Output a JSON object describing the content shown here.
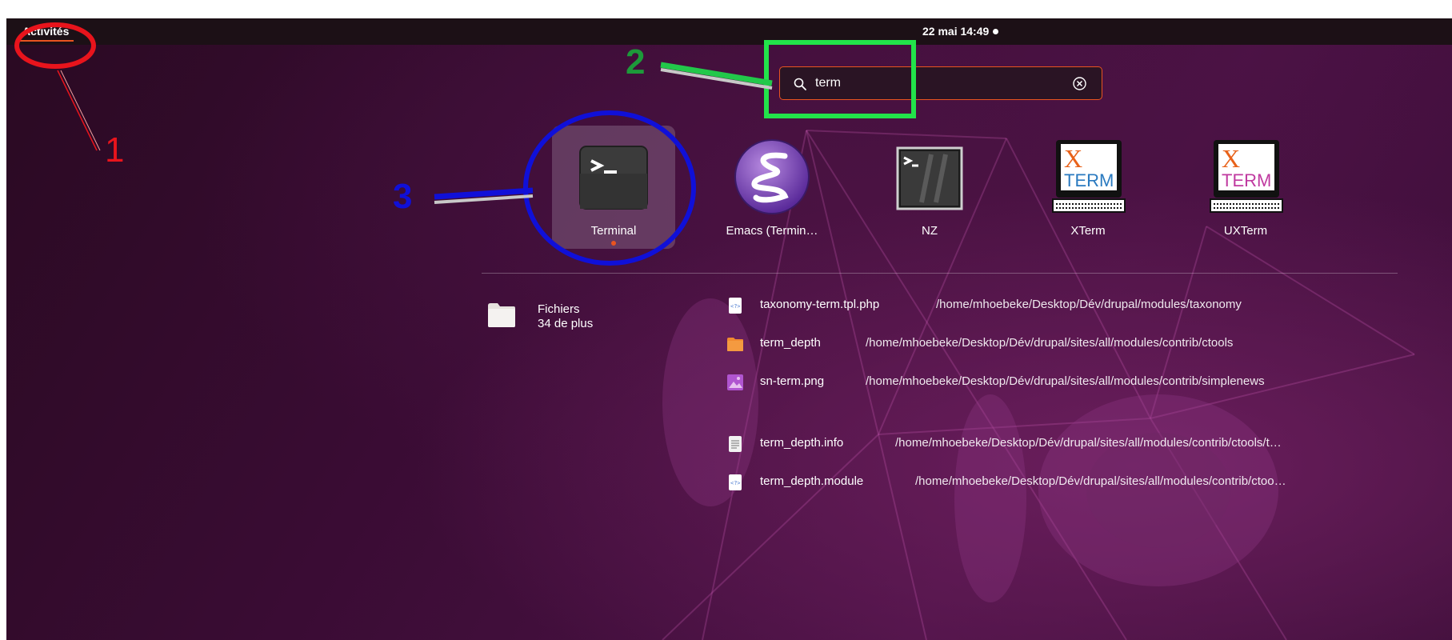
{
  "topbar": {
    "activities_label": "Activités",
    "clock": "22 mai  14:49"
  },
  "search": {
    "value": "term",
    "placeholder": ""
  },
  "apps": [
    {
      "label": "Terminal",
      "icon": "terminal-icon",
      "selected": true,
      "running": true
    },
    {
      "label": "Emacs (Termin…",
      "icon": "emacs-icon"
    },
    {
      "label": "NZ",
      "icon": "nz-terminal-icon"
    },
    {
      "label": "XTerm",
      "icon": "xterm-icon"
    },
    {
      "label": "UXTerm",
      "icon": "uxterm-icon"
    }
  ],
  "files_provider": {
    "name": "Fichiers",
    "more": "34 de plus"
  },
  "results": [
    {
      "name": "taxonomy-term.tpl.php",
      "path": "/home/mhoebeke/Desktop/Dév/drupal/modules/taxonomy",
      "icon": "php-file-icon"
    },
    {
      "name": "term_depth",
      "path": "/home/mhoebeke/Desktop/Dév/drupal/sites/all/modules/contrib/ctools",
      "icon": "folder-icon"
    },
    {
      "name": "sn-term.png",
      "path": "/home/mhoebeke/Desktop/Dév/drupal/sites/all/modules/contrib/simplenews",
      "icon": "image-file-icon"
    },
    {
      "name": "term_depth.info",
      "path": "/home/mhoebeke/Desktop/Dév/drupal/sites/all/modules/contrib/ctools/t…",
      "icon": "text-file-icon"
    },
    {
      "name": "term_depth.module",
      "path": "/home/mhoebeke/Desktop/Dév/drupal/sites/all/modules/contrib/ctoo…",
      "icon": "php-file-icon"
    }
  ],
  "annotations": [
    {
      "number": "1",
      "color": "#e8141c"
    },
    {
      "number": "2",
      "color": "#1d9a3a"
    },
    {
      "number": "3",
      "color": "#1010d8"
    }
  ],
  "colors": {
    "accent": "#e95420",
    "topbar": "#1c1016"
  },
  "xterm_icon_text": {
    "x": "X",
    "term": "TERM"
  }
}
